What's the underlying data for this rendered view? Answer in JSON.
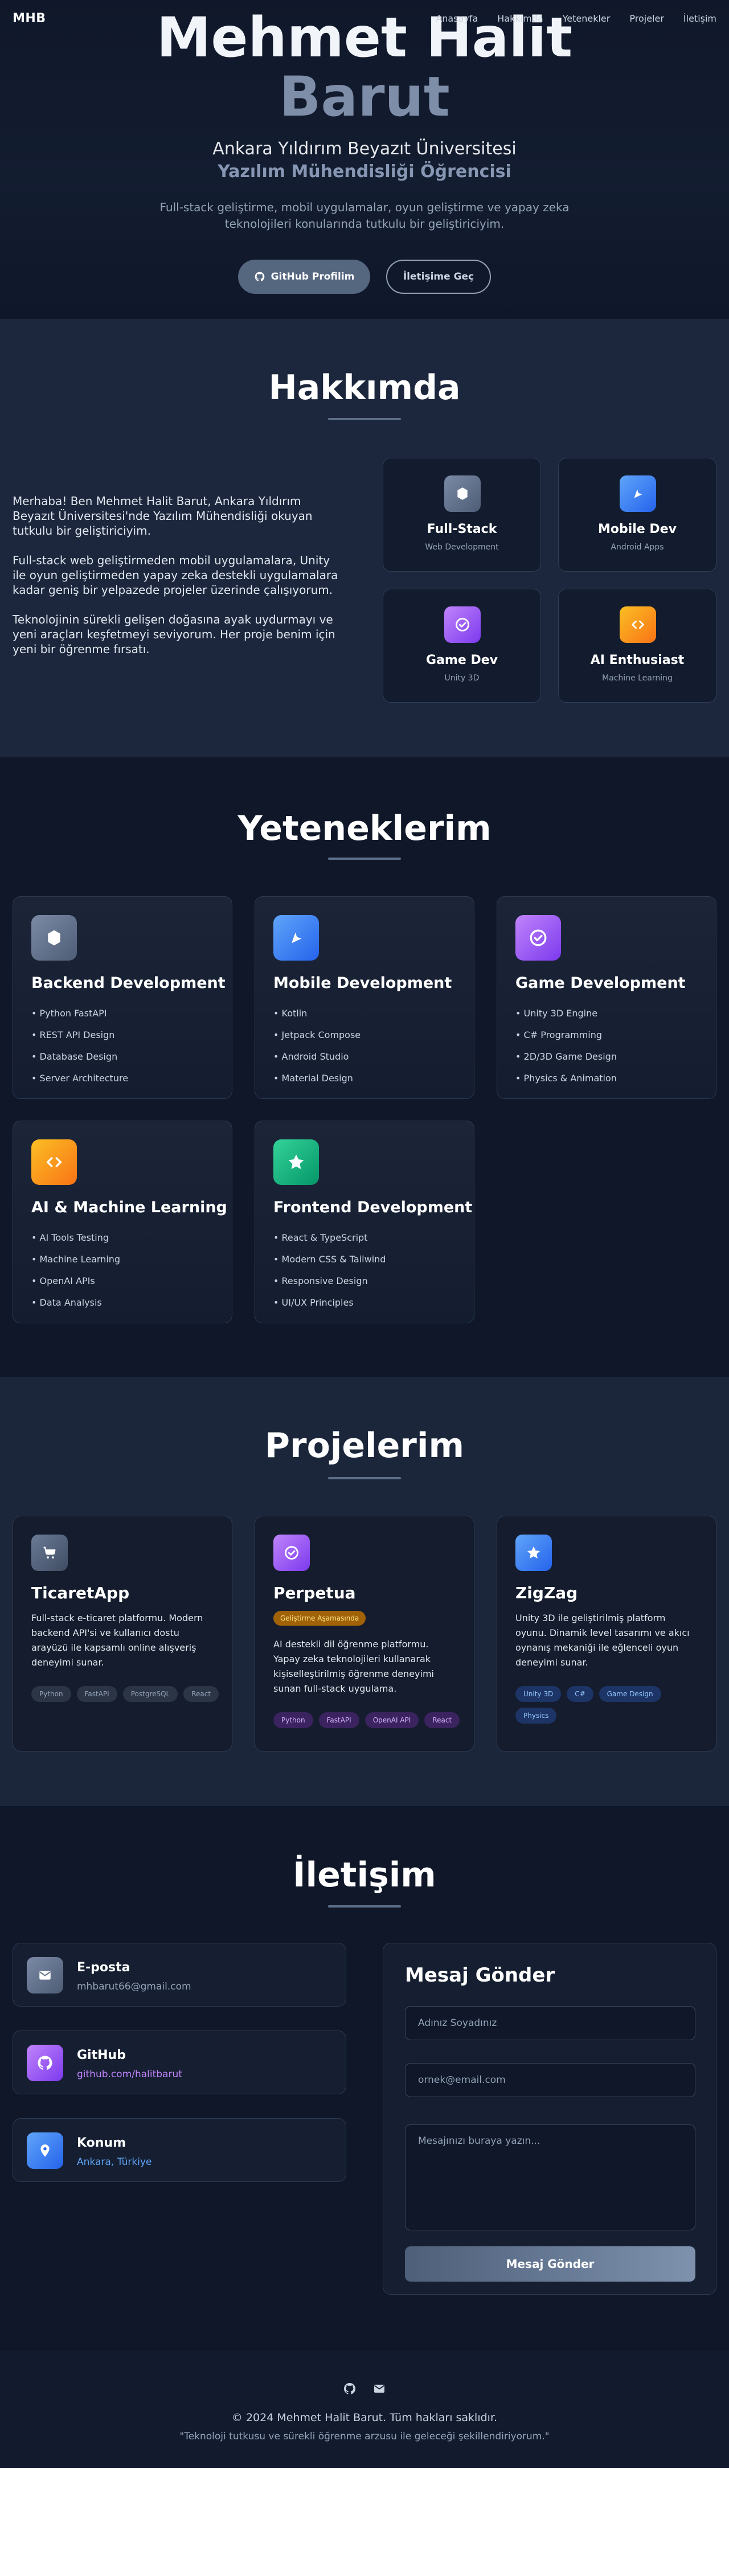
{
  "nav": {
    "logo": "MHB",
    "links": [
      "Anasayfa",
      "Hakkımda",
      "Yetenekler",
      "Projeler",
      "İletişim"
    ]
  },
  "hero": {
    "name_line1": "Mehmet Halit",
    "name_line2": "Barut",
    "university": "Ankara Yıldırım Beyazıt Üniversitesi",
    "role": "Yazılım Mühendisliği Öğrencisi",
    "description": "Full-stack geliştirme, mobil uygulamalar, oyun geliştirme ve yapay zeka teknolojileri konularında tutkulu bir geliştiriciyim.",
    "github_button": "GitHub Profilim",
    "contact_button": "İletişime Geç"
  },
  "about": {
    "title": "Hakkımda",
    "paragraphs": [
      "Merhaba! Ben Mehmet Halit Barut, Ankara Yıldırım Beyazıt Üniversitesi'nde Yazılım Mühendisliği okuyan tutkulu bir geliştiriciyim.",
      "Full-stack web geliştirmeden mobil uygulamalara, Unity ile oyun geliştirmeden yapay zeka destekli uygulamalara kadar geniş bir yelpazede projeler üzerinde çalışıyorum.",
      "Teknolojinin sürekli gelişen doğasına ayak uydurmayı ve yeni araçları keşfetmeyi seviyorum. Her proje benim için yeni bir öğrenme fırsatı."
    ],
    "cards": [
      {
        "title": "Full-Stack",
        "subtitle": "Web Development",
        "icon": "server-icon"
      },
      {
        "title": "Mobile Dev",
        "subtitle": "Android Apps",
        "icon": "mobile-icon"
      },
      {
        "title": "Game Dev",
        "subtitle": "Unity 3D",
        "icon": "gamepad-icon"
      },
      {
        "title": "AI Enthusiast",
        "subtitle": "Machine Learning",
        "icon": "code-icon"
      }
    ]
  },
  "skills": {
    "title": "Yeteneklerim",
    "cards": [
      {
        "title": "Backend Development",
        "icon": "server-icon",
        "items": [
          "Python FastAPI",
          "REST API Design",
          "Database Design",
          "Server Architecture"
        ]
      },
      {
        "title": "Mobile Development",
        "icon": "mobile-icon",
        "items": [
          "Kotlin",
          "Jetpack Compose",
          "Android Studio",
          "Material Design"
        ]
      },
      {
        "title": "Game Development",
        "icon": "gamepad-icon",
        "items": [
          "Unity 3D Engine",
          "C# Programming",
          "2D/3D Game Design",
          "Physics & Animation"
        ]
      },
      {
        "title": "AI & Machine Learning",
        "icon": "code-icon",
        "items": [
          "AI Tools Testing",
          "Machine Learning",
          "OpenAI APIs",
          "Data Analysis"
        ]
      },
      {
        "title": "Frontend Development",
        "icon": "star-icon",
        "items": [
          "React & TypeScript",
          "Modern CSS & Tailwind",
          "Responsive Design",
          "UI/UX Principles"
        ]
      }
    ]
  },
  "projects": {
    "title": "Projelerim",
    "cards": [
      {
        "title": "TicaretApp",
        "icon": "cart-icon",
        "badge": "",
        "description": "Full-stack e-ticaret platformu. Modern backend API'si ve kullanıcı dostu arayüzü ile kapsamlı online alışveriş deneyimi sunar.",
        "tags": [
          "Python",
          "FastAPI",
          "PostgreSQL",
          "React"
        ]
      },
      {
        "title": "Perpetua",
        "icon": "check-circle-icon",
        "badge": "Geliştirme Aşamasında",
        "description": "AI destekli dil öğrenme platformu. Yapay zeka teknolojileri kullanarak kişiselleştirilmiş öğrenme deneyimi sunan full-stack uygulama.",
        "tags": [
          "Python",
          "FastAPI",
          "OpenAI API",
          "React"
        ]
      },
      {
        "title": "ZigZag",
        "icon": "star-icon",
        "badge": "",
        "description": "Unity 3D ile geliştirilmiş platform oyunu. Dinamik level tasarımı ve akıcı oynanış mekaniği ile eğlenceli oyun deneyimi sunar.",
        "tags": [
          "Unity 3D",
          "C#",
          "Game Design",
          "Physics"
        ]
      }
    ]
  },
  "contact": {
    "title": "İletişim",
    "items": [
      {
        "label": "E-posta",
        "value": "mhbarut66@gmail.com",
        "icon": "mail-icon"
      },
      {
        "label": "GitHub",
        "value": "github.com/halitbarut",
        "icon": "github-icon"
      },
      {
        "label": "Konum",
        "value": "Ankara, Türkiye",
        "icon": "location-pin-icon"
      }
    ],
    "form": {
      "title": "Mesaj Gönder",
      "name_placeholder": "Adınız Soyadınız",
      "email_placeholder": "ornek@email.com",
      "message_placeholder": "Mesajınızı buraya yazın...",
      "submit_label": "Mesaj Gönder"
    }
  },
  "footer": {
    "copyright": "© 2024 Mehmet Halit Barut. Tüm hakları saklıdır.",
    "quote": "\"Teknoloji tutkusu ve sürekli öğrenme arzusu ile geleceği şekillendiriyorum.\""
  },
  "colors": {
    "accent": "#55667f",
    "secondary_text": "#8796b2",
    "card_bg": "#141c2d"
  }
}
